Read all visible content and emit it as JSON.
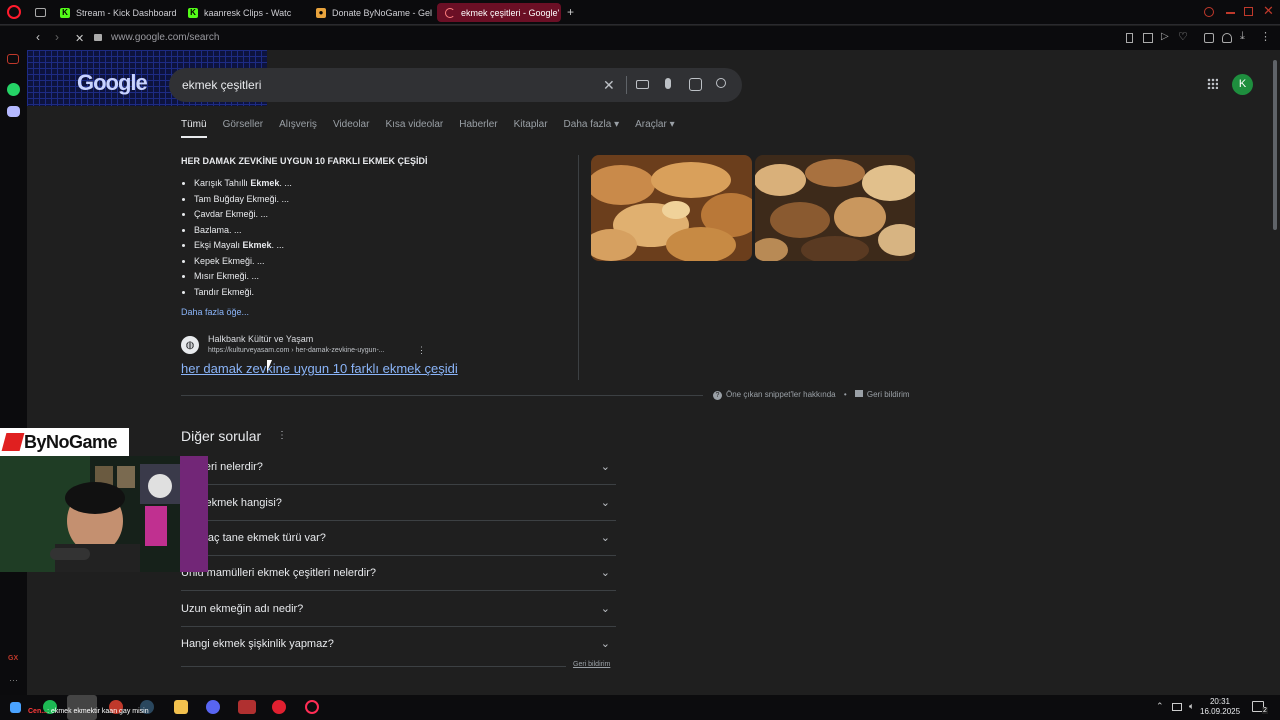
{
  "browser": {
    "tabs": [
      {
        "label": "Stream - Kick Dashboard",
        "color": "#53fc18",
        "glyph": "K"
      },
      {
        "label": "kaanresk Clips - Watc",
        "color": "#53fc18",
        "glyph": "K"
      },
      {
        "label": "Donate ByNoGame - Geli",
        "color": "#e8a33d",
        "glyph": "●"
      },
      {
        "label": "ekmek çeşitleri - Google'",
        "color": "#ff4b4b",
        "glyph": "◌"
      }
    ],
    "new_tab": "+",
    "url": "www.google.com/search"
  },
  "google": {
    "logo": "Google",
    "query": "ekmek çeşitleri",
    "avatar_letter": "K",
    "tabs": [
      "Tümü",
      "Görseller",
      "Alışveriş",
      "Videolar",
      "Kısa videolar",
      "Haberler",
      "Kitaplar",
      "Daha fazla ▾",
      "Araçlar ▾"
    ]
  },
  "snippet": {
    "title": "HER DAMAK ZEVKİNE UYGUN 10 FARKLI EKMEK ÇEŞİDİ",
    "items": [
      {
        "pre": "Karışık Tahıllı ",
        "bold": "Ekmek",
        "post": ". ..."
      },
      {
        "pre": "Tam Buğday Ekmeği. ...",
        "bold": "",
        "post": ""
      },
      {
        "pre": "Çavdar Ekmeği. ...",
        "bold": "",
        "post": ""
      },
      {
        "pre": "Bazlama. ...",
        "bold": "",
        "post": ""
      },
      {
        "pre": "Ekşi Mayalı ",
        "bold": "Ekmek",
        "post": ". ..."
      },
      {
        "pre": "Kepek Ekmeği. ...",
        "bold": "",
        "post": ""
      },
      {
        "pre": "Mısır Ekmeği. ...",
        "bold": "",
        "post": ""
      },
      {
        "pre": "Tandır Ekmeği.",
        "bold": "",
        "post": ""
      }
    ],
    "more": "Daha fazla öğe...",
    "source_name": "Halkbank Kültür ve Yaşam",
    "source_url": "https://kulturveyasam.com › her-damak-zevkine-uygun-...",
    "link": "her damak zevkine uygun 10 farklı ekmek çeşidi",
    "about": "Öne çıkan snippet'ler hakkında",
    "dot": "•",
    "feedback": "Geri bildirim"
  },
  "paa": {
    "title": "Diğer sorular",
    "questions": [
      "k türleri nelerdir?",
      "ğlikli ekmek hangisi?",
      "ada kaç tane ekmek türü var?",
      "Unlu mamülleri ekmek çeşitleri nelerdir?",
      "Uzun ekmeğin adı nedir?",
      "Hangi ekmek şişkinlik yapmaz?"
    ],
    "feedback": "Geri bildirim"
  },
  "overlay": {
    "brand": "ByNoGame",
    "chat_user": "Cen...",
    "chat_message": ": ekmek ekmektir kaan gay misin"
  },
  "taskbar": {
    "time": "20:31",
    "date": "16.09.2025",
    "badge": "2"
  }
}
